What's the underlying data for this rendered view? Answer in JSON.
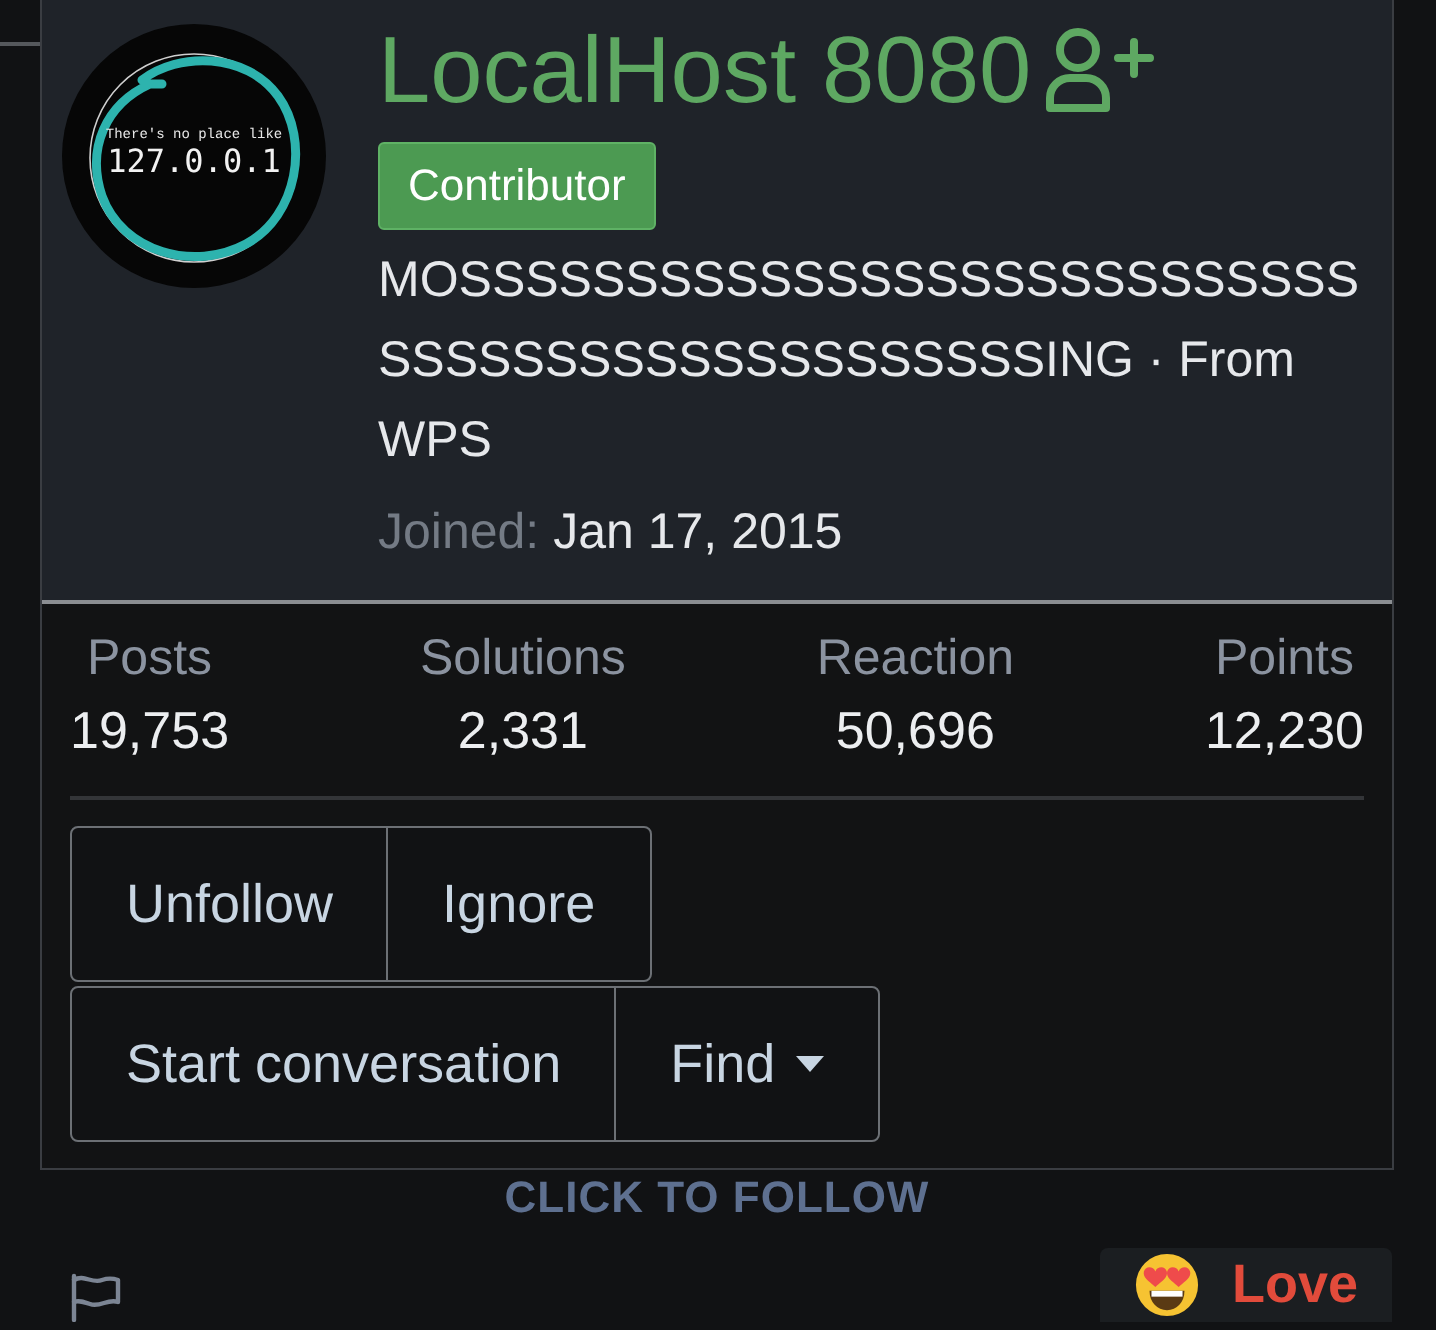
{
  "avatar": {
    "caption": "There's no place like",
    "address": "127.0.0.1"
  },
  "user": {
    "name": "LocalHost 8080",
    "badge": "Contributor",
    "title": "MOSSSSSSSSSSSSSSSSSSSSSSSSSSSSSSSSSSSSSSSSSSSSSSSING · From WPS",
    "joined_label": "Joined:",
    "joined_date": "Jan 17, 2015"
  },
  "stats": [
    {
      "label": "Posts",
      "value": "19,753"
    },
    {
      "label": "Solutions",
      "value": "2,331"
    },
    {
      "label": "Reaction",
      "value": "50,696"
    },
    {
      "label": "Points",
      "value": "12,230"
    }
  ],
  "action_rows": [
    {
      "buttons": [
        {
          "label": "Unfollow",
          "kind": "plain"
        },
        {
          "label": "Ignore",
          "kind": "plain"
        }
      ]
    },
    {
      "buttons": [
        {
          "label": "Start conversation",
          "kind": "plain"
        },
        {
          "label": "Find",
          "kind": "dropdown"
        }
      ]
    }
  ],
  "follow_link": "CLICK TO FOLLOW",
  "reaction": {
    "label": "Love"
  }
}
